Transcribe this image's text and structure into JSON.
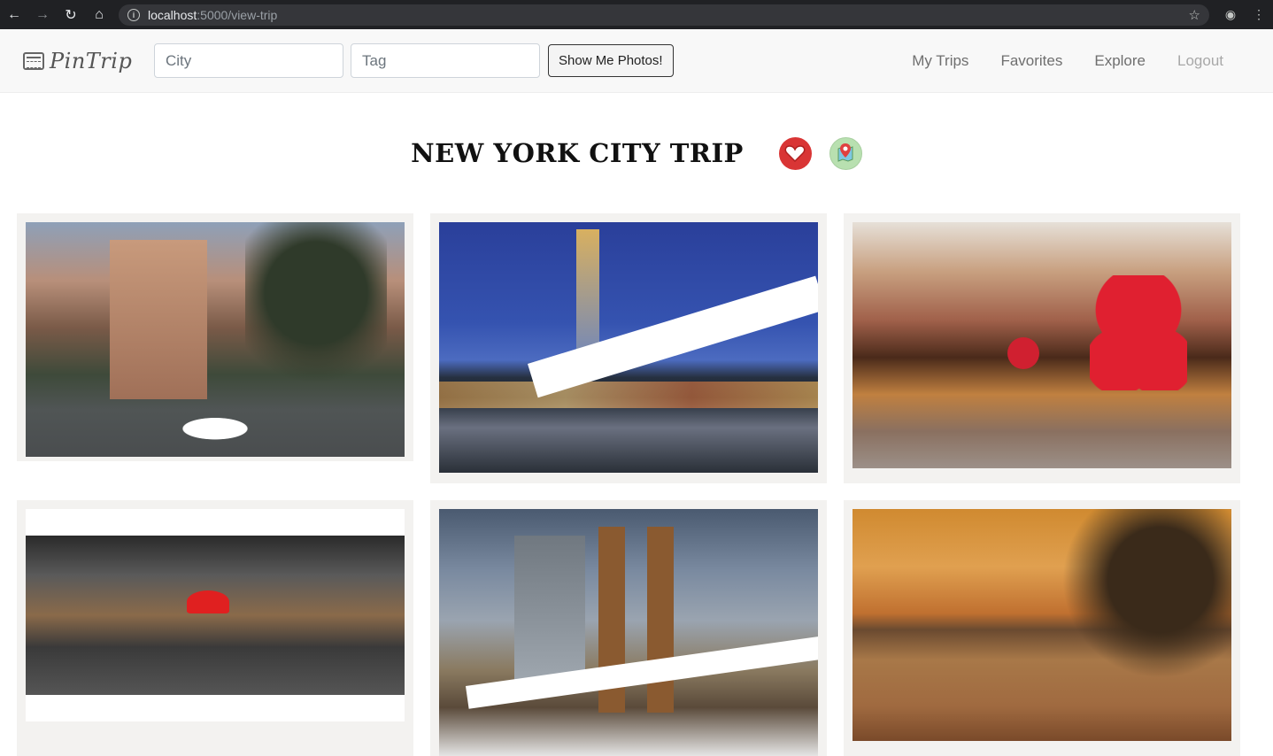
{
  "browser": {
    "url_host": "localhost",
    "url_path": ":5000/view-trip"
  },
  "navbar": {
    "brand": "PinTrip",
    "city_placeholder": "City",
    "tag_placeholder": "Tag",
    "search_button": "Show Me Photos!",
    "links": [
      "My Trips",
      "Favorites",
      "Explore",
      "Logout"
    ]
  },
  "trip": {
    "title": "NEW YORK CITY TRIP"
  },
  "colors": {
    "favorite": "#d93535",
    "map": "#b8e0b0",
    "card_bg": "#f3f2f0"
  },
  "photos": [
    {
      "subject": "flatiron-building-park"
    },
    {
      "subject": "manhattan-bridge-night"
    },
    {
      "subject": "rockefeller-ornaments"
    },
    {
      "subject": "bridge-walkway-red-umbrella"
    },
    {
      "subject": "brooklyn-bridge"
    },
    {
      "subject": "waterfront-sunset"
    }
  ]
}
